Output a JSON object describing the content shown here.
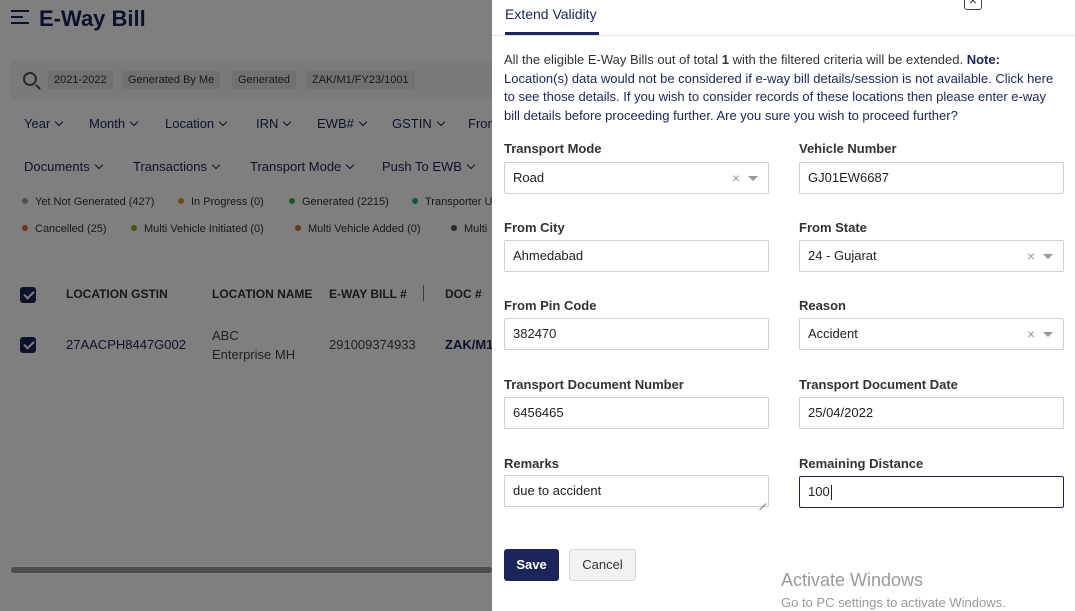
{
  "background": {
    "title": "E-Way Bill",
    "chips": [
      "2021-2022",
      "Generated By Me",
      "Generated",
      "ZAK/M1/FY23/1001"
    ],
    "filters_row1": [
      "Year",
      "Month",
      "Location",
      "IRN",
      "EWB#",
      "GSTIN",
      "From"
    ],
    "filters_row2": [
      "Documents",
      "Transactions",
      "Transport Mode",
      "Push To EWB"
    ],
    "legend_row1": [
      {
        "label": "Yet Not Generated (427)",
        "color": "#9e9e9e"
      },
      {
        "label": "In Progress (0)",
        "color": "#e0a020"
      },
      {
        "label": "Generated (2215)",
        "color": "#3aa84a"
      },
      {
        "label": "Transporter U",
        "color": "#20a89a"
      }
    ],
    "legend_row2": [
      {
        "label": "Cancelled (25)",
        "color": "#e06a2a"
      },
      {
        "label": "Multi Vehicle Initiated (0)",
        "color": "#8aaa20"
      },
      {
        "label": "Multi Vehicle Added (0)",
        "color": "#d07030"
      },
      {
        "label": "Multi",
        "color": "#555555"
      }
    ],
    "table": {
      "headers": [
        "LOCATION GSTIN",
        "LOCATION NAME",
        "E-WAY BILL #",
        "DOC #"
      ],
      "row": {
        "gstin": "27AACPH8447G002",
        "name_line1": "ABC",
        "name_line2": "Enterprise MH",
        "ewb": "291009374933",
        "doc": "ZAK/M1"
      }
    }
  },
  "panel": {
    "tab_label": "Extend Validity",
    "info": {
      "prefix": "All the eligible E-Way Bills out of total ",
      "count": "1",
      "suffix": " with the filtered criteria will be extended. ",
      "note_label": "Note:",
      "note_text": " Location(s) data would not be considered if e-way bill details/session is not available. Click here to see those details. If you wish to consider records of these locations then please enter e-way bill details before proceeding further. Are you sure you wish to proceed further?"
    },
    "fields": {
      "transport_mode": {
        "label": "Transport Mode",
        "value": "Road"
      },
      "vehicle_number": {
        "label": "Vehicle Number",
        "value": "GJ01EW6687"
      },
      "from_city": {
        "label": "From City",
        "value": "Ahmedabad"
      },
      "from_state": {
        "label": "From State",
        "value": "24 - Gujarat"
      },
      "from_pin": {
        "label": "From Pin Code",
        "value": "382470"
      },
      "reason": {
        "label": "Reason",
        "value": "Accident"
      },
      "doc_number": {
        "label": "Transport Document Number",
        "value": "6456465"
      },
      "doc_date": {
        "label": "Transport Document Date",
        "value": "25/04/2022"
      },
      "remarks": {
        "label": "Remarks",
        "value": "due to accident"
      },
      "remaining_distance": {
        "label": "Remaining Distance",
        "value": "100"
      }
    },
    "clear_symbol": "×",
    "close_symbol": "×",
    "save_label": "Save",
    "cancel_label": "Cancel"
  },
  "watermark": {
    "title": "Activate Windows",
    "subtitle": "Go to PC settings to activate Windows."
  },
  "colors": {
    "primary": "#1b2559"
  }
}
